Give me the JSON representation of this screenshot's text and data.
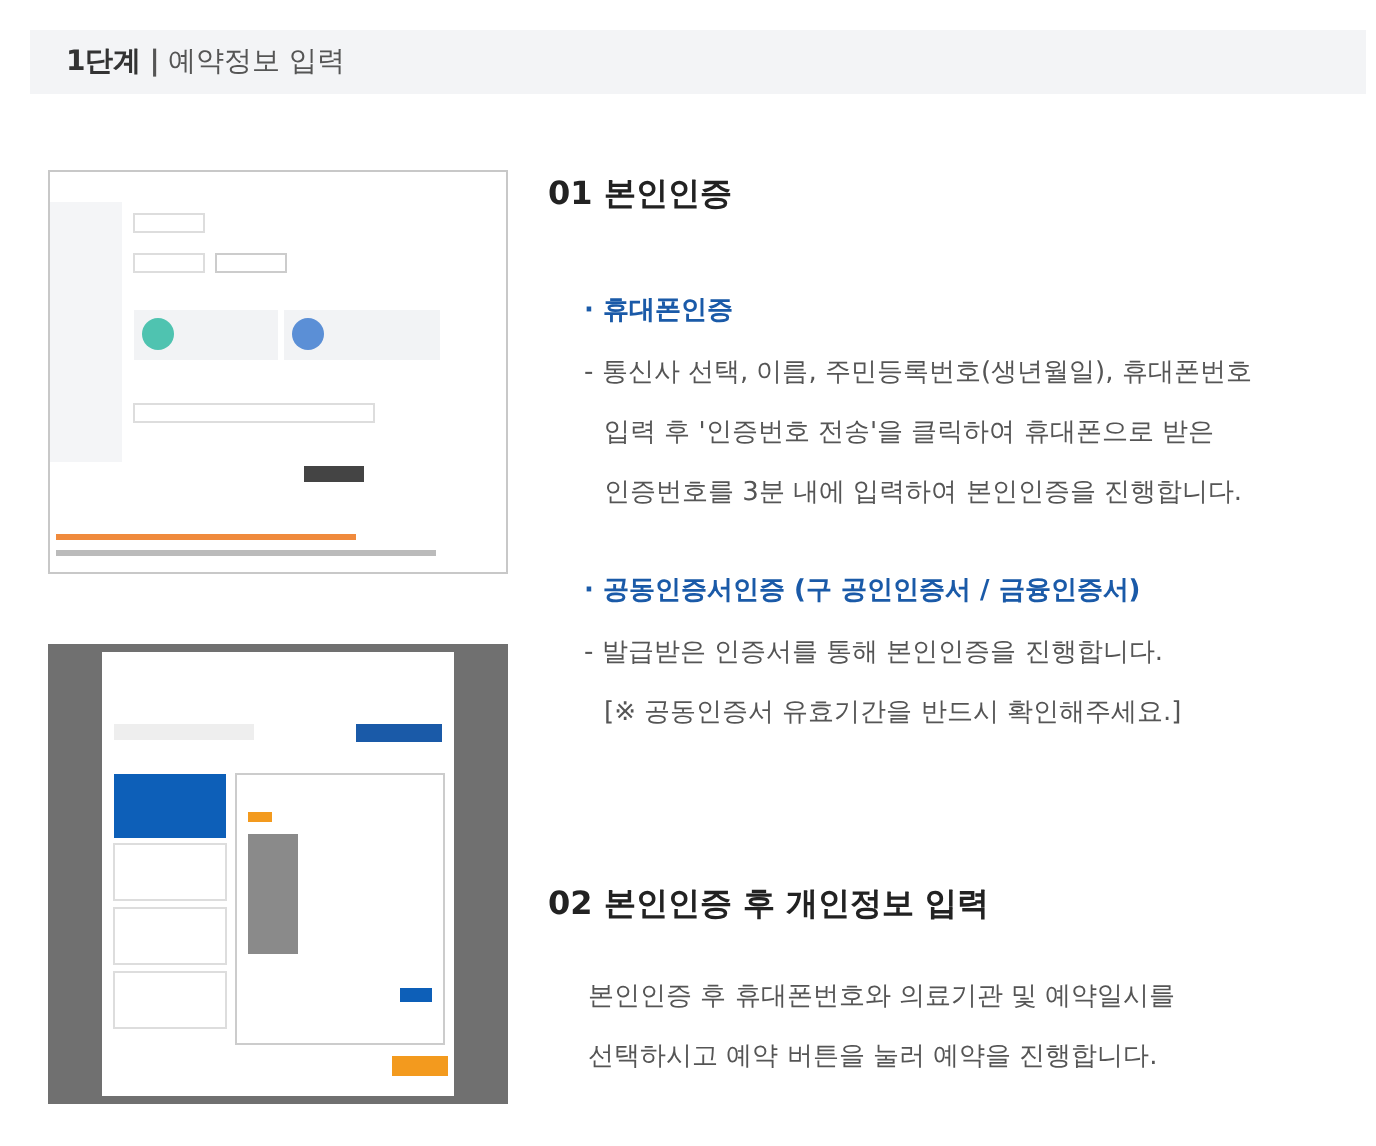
{
  "step": {
    "label": "1단계",
    "separator": "|",
    "title": "예약정보 입력"
  },
  "sections": [
    {
      "number": "01",
      "title": "본인인증",
      "blocks": [
        {
          "kind": "method",
          "title": "· 휴대폰인증",
          "lines": [
            "- 통신사 선택, 이름, 주민등록번호(생년월일), 휴대폰번호",
            "입력 후 '인증번호 전송'을 클릭하여 휴대폰으로 받은",
            "인증번호를 3분 내에 입력하여 본인인증을 진행합니다."
          ]
        },
        {
          "kind": "method",
          "title": "· 공동인증서인증 (구 공인인증서 / 금융인증서)",
          "lines": [
            "- 발급받은 인증서를 통해 본인인증을 진행합니다.",
            "[※ 공동인증서 유효기간을 반드시 확인해주세요.]"
          ]
        }
      ]
    },
    {
      "number": "02",
      "title": "본인인증 후 개인정보 입력",
      "blocks": [
        {
          "kind": "text",
          "lines": [
            "본인인증 후 휴대폰번호와 의료기관 및 예약일시를",
            "선택하시고 예약 버튼을 눌러 예약을 진행합니다."
          ]
        }
      ]
    }
  ]
}
